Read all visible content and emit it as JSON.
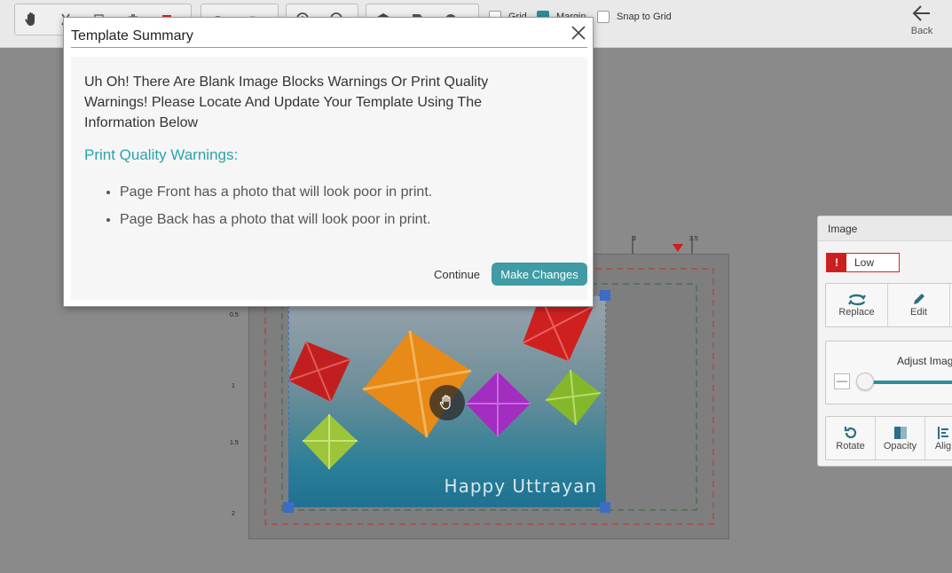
{
  "toolbar": {
    "groups": [
      {
        "icons": [
          "hand-icon",
          "cut-icon",
          "copy-icon",
          "paste-icon",
          "delete-icon"
        ]
      },
      {
        "icons": [
          "undo-icon",
          "redo-icon"
        ]
      },
      {
        "icons": [
          "zoom-in-icon",
          "zoom-out-icon"
        ]
      },
      {
        "icons": [
          "arrange-icon",
          "page-icon",
          "layer-icon"
        ]
      }
    ],
    "checkboxes": [
      {
        "label": "Grid",
        "checked": false
      },
      {
        "label": "Margin",
        "checked": true
      },
      {
        "label": "Snap to Grid",
        "checked": false
      }
    ],
    "back_label": "Back"
  },
  "ruler": {
    "top_ticks": [
      "3",
      "3.5"
    ],
    "left_ticks": [
      "0.5",
      "1",
      "1.5",
      "2"
    ]
  },
  "canvas": {
    "photo_caption": "Happy Uttrayan"
  },
  "image_panel": {
    "title": "Image",
    "quality_label": "Low",
    "quality_icon": "!",
    "actions_row1": [
      {
        "label": "Replace",
        "icon": "replace-icon"
      },
      {
        "label": "Edit",
        "icon": "edit-icon"
      }
    ],
    "adjust_label": "Adjust Image",
    "minus_label": "—",
    "actions_row2": [
      {
        "label": "Rotate",
        "icon": "rotate-icon"
      },
      {
        "label": "Opacity",
        "icon": "opacity-icon"
      },
      {
        "label": "Alig",
        "icon": "align-icon"
      }
    ]
  },
  "modal": {
    "title": "Template Summary",
    "message": "Uh Oh! There Are Blank Image Blocks Warnings Or Print Quality Warnings! Please Locate And Update Your Template Using The Information Below",
    "warnings_heading": "Print Quality Warnings:",
    "warnings": [
      "Page Front has a photo that will look poor in print.",
      "Page Back has a photo that will look poor in print."
    ],
    "continue_label": "Continue",
    "make_changes_label": "Make Changes"
  },
  "colors": {
    "accent": "#3f9ca4",
    "warning_heading": "#2aa3ad",
    "quality_low": "#cc1f1f",
    "selection_handle": "#3d6cc4"
  }
}
